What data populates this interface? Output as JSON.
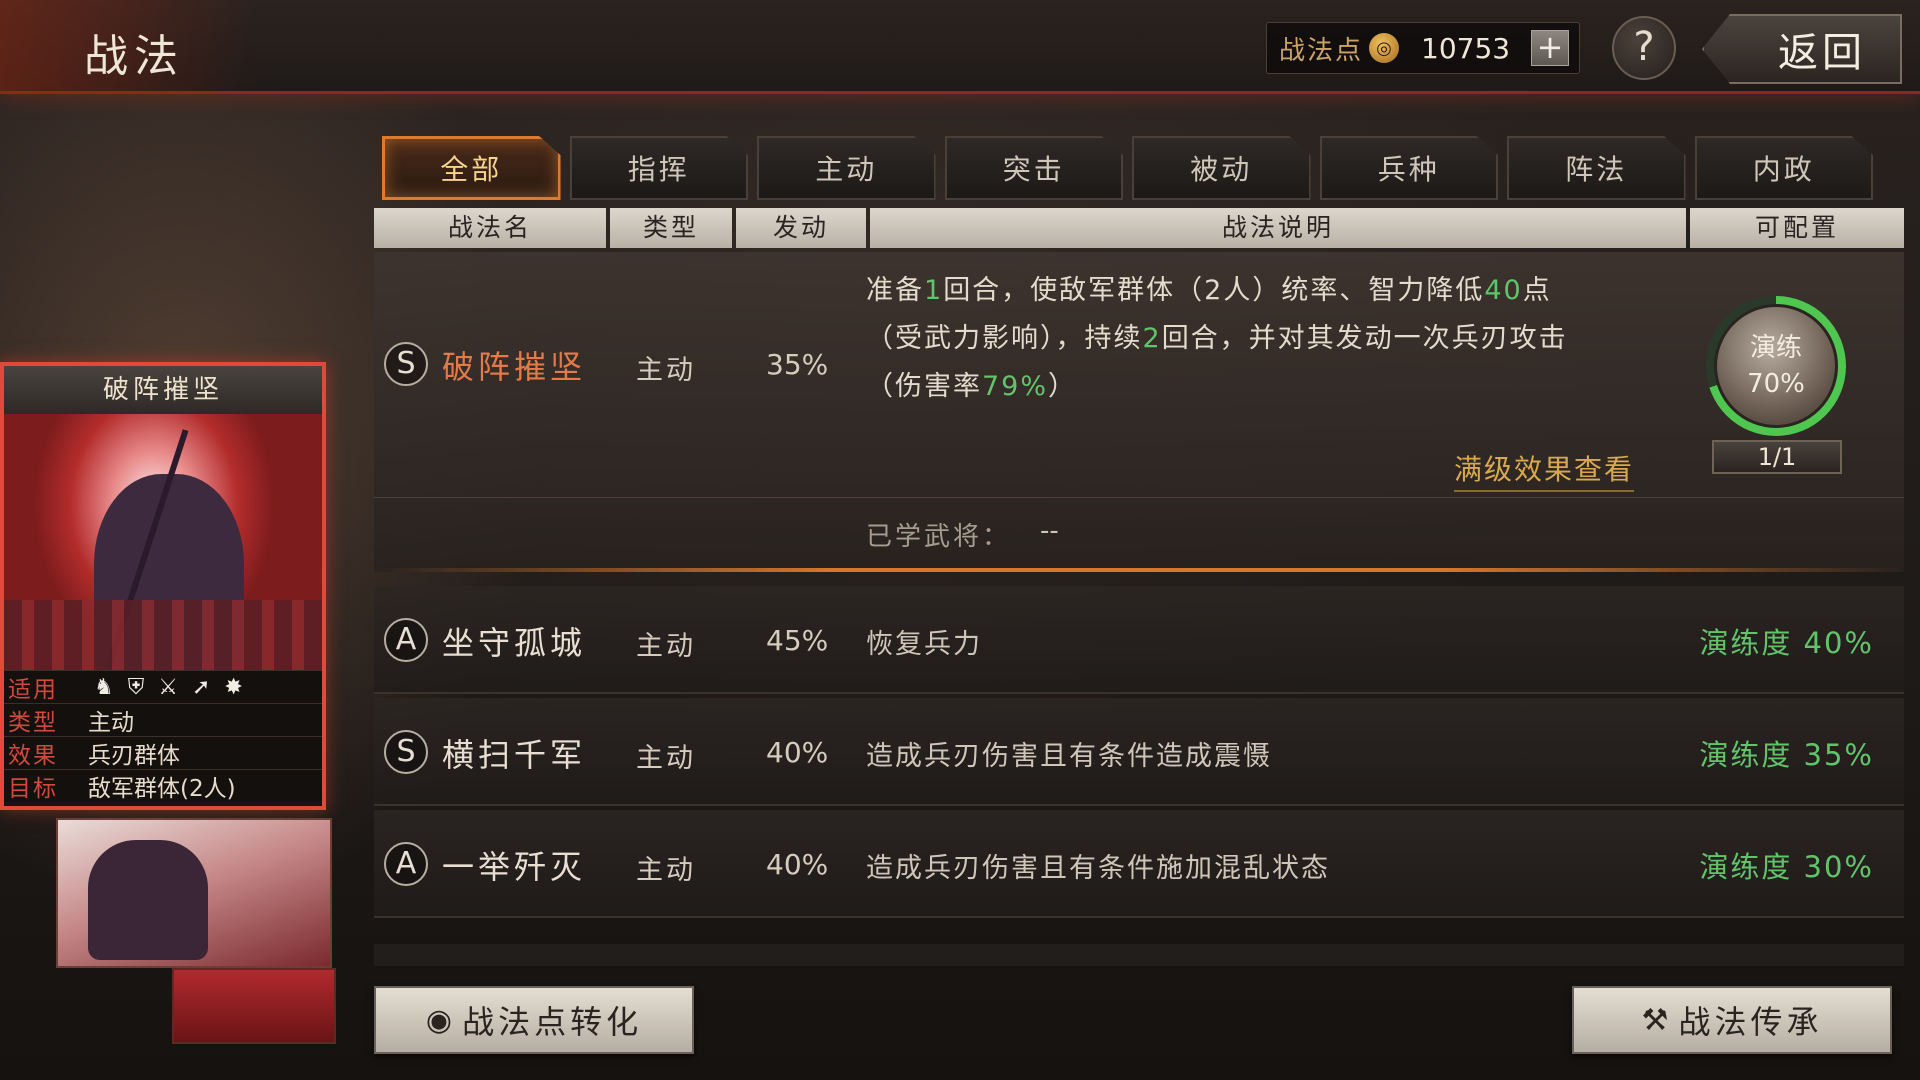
{
  "header": {
    "title": "战法",
    "points_label": "战法点",
    "points_icon": "flame-coin-icon",
    "points_value": "10753",
    "add_label": "+",
    "help_label": "?",
    "back_label": "返回"
  },
  "tabs": [
    {
      "label": "全部",
      "active": true
    },
    {
      "label": "指挥",
      "active": false
    },
    {
      "label": "主动",
      "active": false
    },
    {
      "label": "突击",
      "active": false
    },
    {
      "label": "被动",
      "active": false
    },
    {
      "label": "兵种",
      "active": false
    },
    {
      "label": "阵法",
      "active": false
    },
    {
      "label": "内政",
      "active": false
    }
  ],
  "columns": {
    "name": "战法名",
    "type": "类型",
    "trigger": "发动",
    "description": "战法说明",
    "configurable": "可配置"
  },
  "selected_skill": {
    "grade": "S",
    "name": "破阵摧坚",
    "type": "主动",
    "rate": "35%",
    "desc": {
      "l1a": "准备",
      "l1b": "1",
      "l1c": "回合，使敌军群体（2人）统率、智力降低",
      "l1d": "40",
      "l1e": "点",
      "l2a": "（受武力影响），持续",
      "l2b": "2",
      "l2c": "回合，并对其发动一次兵刃攻击",
      "l3a": "（伤害率",
      "l3b": "79%",
      "l3c": "）"
    },
    "max_level_link": "满级效果查看",
    "drill_label": "演练",
    "drill_percent": "70%",
    "drill_fraction": 0.7,
    "config_count": "1/1",
    "learned_label": "已学武将：",
    "learned_value": "--"
  },
  "skill_list": [
    {
      "grade": "A",
      "name": "坐守孤城",
      "type": "主动",
      "rate": "45%",
      "desc": "恢复兵力",
      "progress": "演练度 40%"
    },
    {
      "grade": "S",
      "name": "横扫千军",
      "type": "主动",
      "rate": "40%",
      "desc": "造成兵刃伤害且有条件造成震慑",
      "progress": "演练度 35%"
    },
    {
      "grade": "A",
      "name": "一举歼灭",
      "type": "主动",
      "rate": "40%",
      "desc": "造成兵刃伤害且有条件施加混乱状态",
      "progress": "演练度 30%"
    }
  ],
  "card": {
    "title": "破阵摧坚",
    "apply_label": "适用",
    "apply_icons": [
      "cavalry-icon",
      "shield-icon",
      "crossed-bow-icon",
      "spear-icon",
      "wheel-icon"
    ],
    "type_label": "类型",
    "type_value": "主动",
    "effect_label": "效果",
    "effect_value": "兵刃群体",
    "target_label": "目标",
    "target_value": "敌军群体(2人)"
  },
  "bottom": {
    "convert_label": "战法点转化",
    "inherit_label": "战法传承"
  },
  "colors": {
    "accent_orange": "#e07a2a",
    "highlight_green": "#62c46a",
    "card_border_red": "#e04a3a",
    "link_gold": "#d9a94e"
  }
}
